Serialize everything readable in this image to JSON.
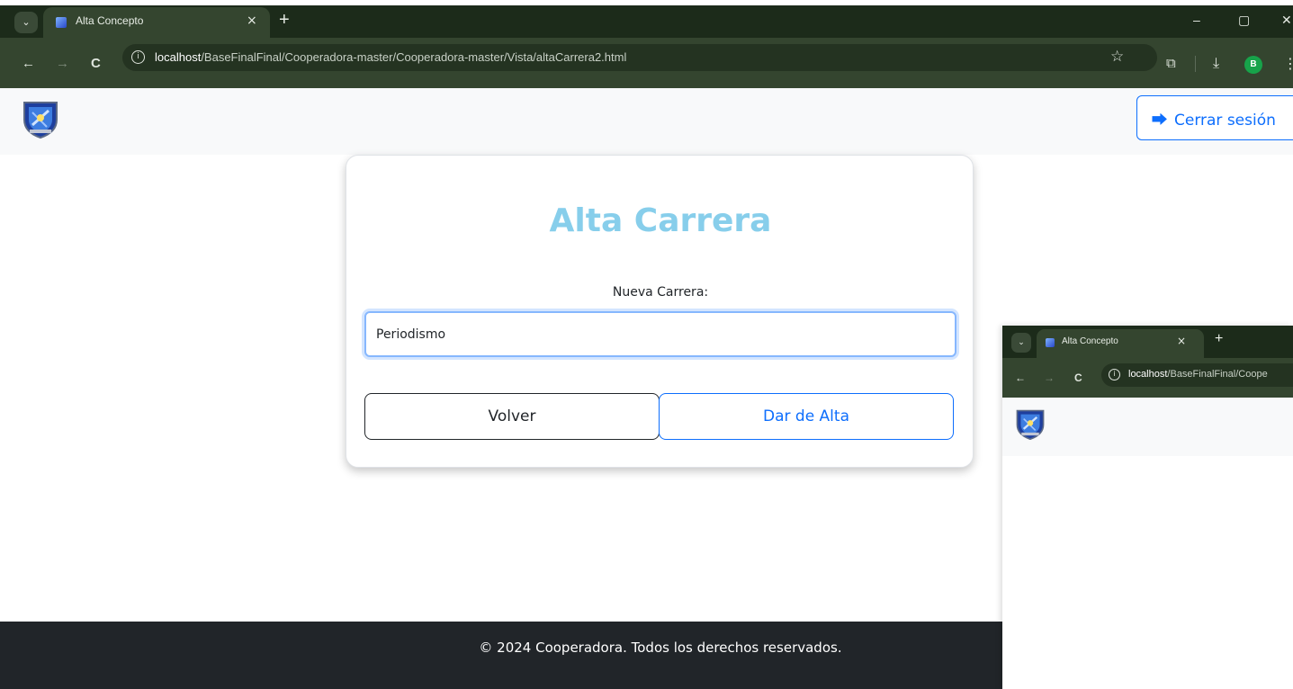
{
  "browser": {
    "tab_dropdown_glyph": "⌄",
    "tab_title": "Alta Concepto",
    "tab_close_glyph": "×",
    "new_tab_glyph": "+",
    "window_controls": [
      "–",
      "▢",
      "✕"
    ],
    "nav": {
      "back": "←",
      "forward": "→",
      "reload": "C"
    },
    "info_glyph": "i",
    "url_host": "localhost",
    "url_path": "/BaseFinalFinal/Cooperadora-master/Cooperadora-master/Vista/altaCarrera2.html",
    "bookmark_glyph": "☆",
    "extensions_glyph": "⧉",
    "download_glyph": "⤓",
    "profile_initial": "B",
    "menu_glyph": "⋮"
  },
  "navbar": {
    "logout_label": "Cerrar sesión",
    "logout_icon": "⮕"
  },
  "form": {
    "title": "Alta Carrera",
    "label": "Nueva Carrera:",
    "value": "Periodismo",
    "back_button": "Volver",
    "submit_button": "Dar de Alta"
  },
  "footer": {
    "text": "© 2024 Cooperadora. Todos los derechos reservados."
  },
  "second_window": {
    "tab_title": "Alta Concepto",
    "url_host": "localhost",
    "url_path": "/BaseFinalFinal/Coope"
  },
  "colors": {
    "title": "#87ceeb",
    "primary": "#0d6efd",
    "footer_bg": "#212529",
    "chrome_dark": "#1c2b1a",
    "chrome": "#34452f"
  },
  "icons": {
    "logo": "crest-logo",
    "logout": "sign-out-icon",
    "favicon": "crest-favicon"
  }
}
